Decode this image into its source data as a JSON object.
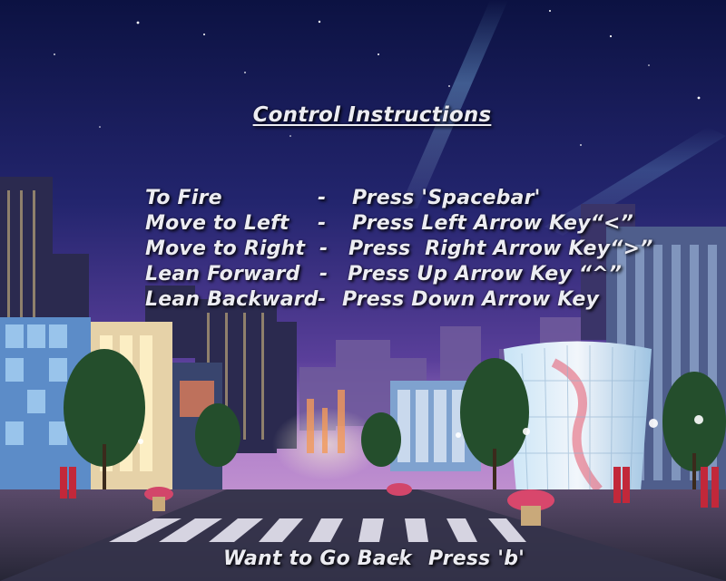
{
  "screen": {
    "title": "Control Instructions",
    "controls": [
      {
        "label": "To Fire",
        "separator": "-",
        "action": "Press 'Spacebar'"
      },
      {
        "label": "Move to Left",
        "separator": "-",
        "action": "Press Left Arrow Key“<”"
      },
      {
        "label": "Move to Right",
        "separator": "-",
        "action": "Press  Right Arrow Key“>”"
      },
      {
        "label": "Lean Forward",
        "separator": "-",
        "action": "Press Up Arrow Key “^”"
      },
      {
        "label": "Lean Backward",
        "separator": "-",
        "action": "Press Down Arrow Key"
      }
    ],
    "footer": {
      "label": "Want to Go Back",
      "separator": "-",
      "action": "Press 'b'"
    }
  },
  "colors": {
    "sky_top": "#0e1445",
    "sky_mid": "#3c2d86",
    "sky_horizon": "#b07fc8",
    "text": "#ececf2",
    "street": "#2a2a3c"
  }
}
